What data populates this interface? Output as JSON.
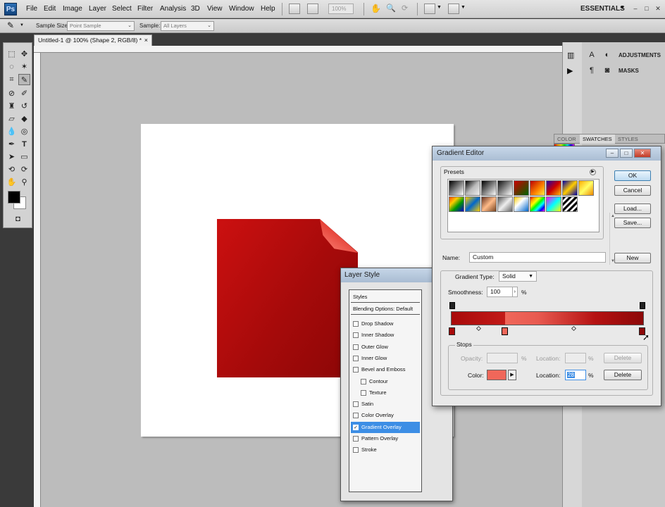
{
  "menubar": {
    "logo": "Ps",
    "items": [
      "File",
      "Edit",
      "Image",
      "Layer",
      "Select",
      "Filter",
      "Analysis",
      "3D",
      "View",
      "Window",
      "Help"
    ],
    "zoom": "100%",
    "workspace": "ESSENTIALS",
    "window_controls": [
      "–",
      "□",
      "✕"
    ]
  },
  "options": {
    "sample_size_label": "Sample Size:",
    "sample_size_value": "Point Sample",
    "sample_label": "Sample:",
    "sample_value": "All Layers"
  },
  "document": {
    "tab_title": "Untitled-1 @ 100% (Shape 2, RGB/8) *",
    "close": "×"
  },
  "panels": {
    "adjustments": "ADJUSTMENTS",
    "masks": "MASKS",
    "swatch_tabs": [
      "COLOR",
      "SWATCHES",
      "STYLES"
    ]
  },
  "layer_style": {
    "title": "Layer Style",
    "styles_header": "Styles",
    "blending_header": "Blending Options: Default",
    "items": [
      {
        "label": "Drop Shadow",
        "checked": false
      },
      {
        "label": "Inner Shadow",
        "checked": false
      },
      {
        "label": "Outer Glow",
        "checked": false
      },
      {
        "label": "Inner Glow",
        "checked": false
      },
      {
        "label": "Bevel and Emboss",
        "checked": false
      },
      {
        "label": "Contour",
        "checked": false
      },
      {
        "label": "Texture",
        "checked": false
      },
      {
        "label": "Satin",
        "checked": false
      },
      {
        "label": "Color Overlay",
        "checked": false
      },
      {
        "label": "Gradient Overlay",
        "checked": true
      },
      {
        "label": "Pattern Overlay",
        "checked": false
      },
      {
        "label": "Stroke",
        "checked": false
      }
    ]
  },
  "gradient_editor": {
    "title": "Gradient Editor",
    "presets_label": "Presets",
    "buttons": {
      "ok": "OK",
      "cancel": "Cancel",
      "load": "Load...",
      "save": "Save...",
      "new": "New"
    },
    "name_label": "Name:",
    "name_value": "Custom",
    "gradient_type_label": "Gradient Type:",
    "gradient_type_value": "Solid",
    "smoothness_label": "Smoothness:",
    "smoothness_value": "100",
    "percent": "%",
    "stops_label": "Stops",
    "opacity_label": "Opacity:",
    "location_label": "Location:",
    "delete_label": "Delete",
    "color_label": "Color:",
    "active_location": "28",
    "active_color": "#f0675a"
  }
}
